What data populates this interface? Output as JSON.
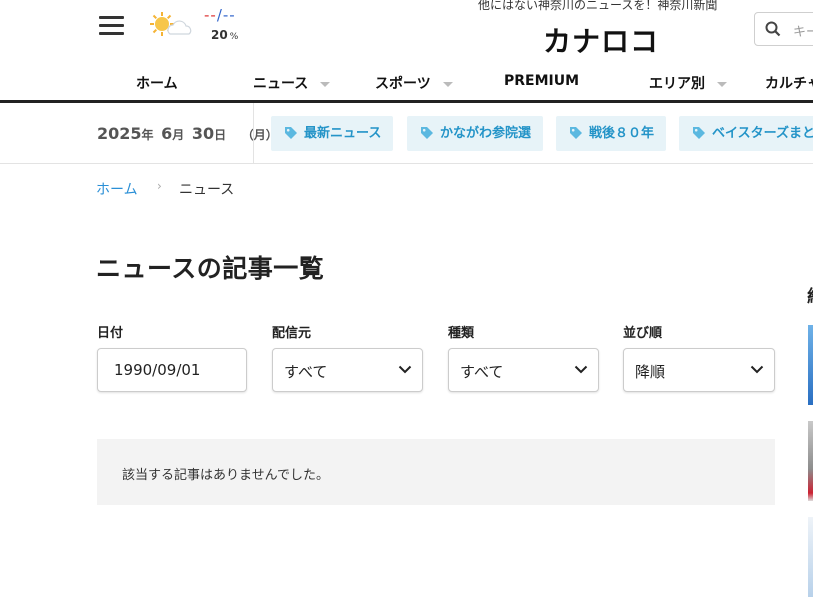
{
  "header": {
    "tagline": "他にはない神奈川のニュースを！神奈川新聞",
    "logo": "カナロコ",
    "weather": {
      "temp_high": "--",
      "temp_sep": "/",
      "temp_low": "--",
      "rain": "20",
      "rain_unit": "%"
    },
    "search_placeholder": "キー"
  },
  "nav": [
    {
      "label": "ホーム",
      "dropdown": false
    },
    {
      "label": "ニュース",
      "dropdown": true
    },
    {
      "label": "スポーツ",
      "dropdown": true
    },
    {
      "label": "PREMIUM",
      "dropdown": false
    },
    {
      "label": "エリア別",
      "dropdown": true
    },
    {
      "label": "カルチャ",
      "dropdown": false
    }
  ],
  "date": {
    "year": "2025",
    "year_unit": "年",
    "month": "6",
    "month_unit": "月",
    "day": "30",
    "day_unit": "日",
    "weekday": "（月）"
  },
  "tags": [
    "最新ニュース",
    "かながわ参院選",
    "戦後８０年",
    "ベイスターズまと"
  ],
  "breadcrumb": {
    "home": "ホーム",
    "sep": "›",
    "current": "ニュース"
  },
  "page_title": "ニュースの記事一覧",
  "filters": [
    {
      "label": "日付",
      "value": "1990/09/01"
    },
    {
      "label": "配信元",
      "value": "すべて"
    },
    {
      "label": "種類",
      "value": "すべて"
    },
    {
      "label": "並び順",
      "value": "降順"
    }
  ],
  "empty_message": "該当する記事はありませんでした。",
  "sidebar": {
    "heading": "紀"
  },
  "colors": {
    "accent": "#2494c8",
    "tag_bg": "#e7f3f8",
    "link": "#2a8fd6"
  }
}
